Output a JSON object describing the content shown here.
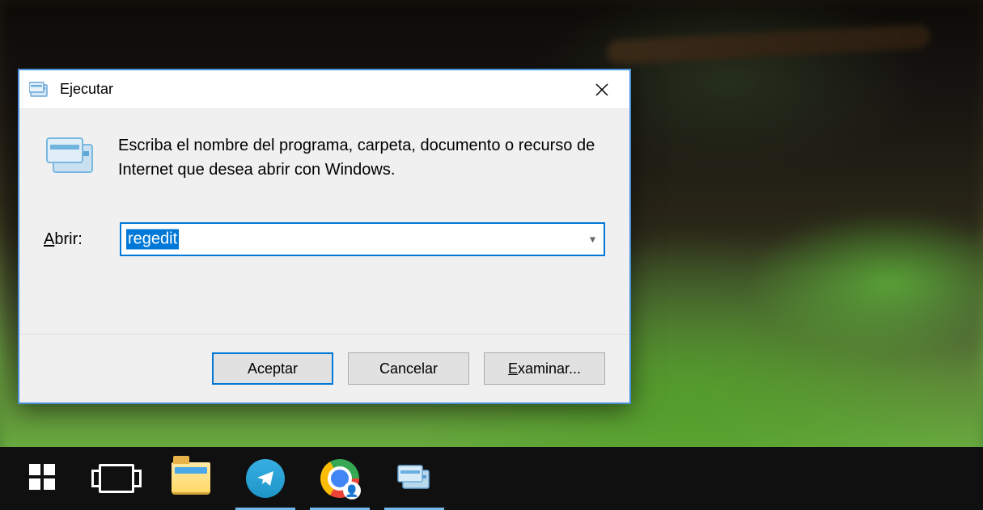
{
  "dialog": {
    "title": "Ejecutar",
    "instruction": "Escriba el nombre del programa, carpeta, documento o recurso de Internet que desea abrir con Windows.",
    "open_label_prefix": "A",
    "open_label_rest": "brir:",
    "input_value": "regedit",
    "buttons": {
      "accept": "Aceptar",
      "cancel": "Cancelar",
      "browse_prefix": "E",
      "browse_rest": "xaminar..."
    }
  },
  "taskbar": {
    "items": [
      {
        "name": "start",
        "active": false
      },
      {
        "name": "task-view",
        "active": false
      },
      {
        "name": "file-explorer",
        "active": false
      },
      {
        "name": "telegram",
        "active": true
      },
      {
        "name": "chrome",
        "active": true
      },
      {
        "name": "run",
        "active": true
      }
    ]
  }
}
